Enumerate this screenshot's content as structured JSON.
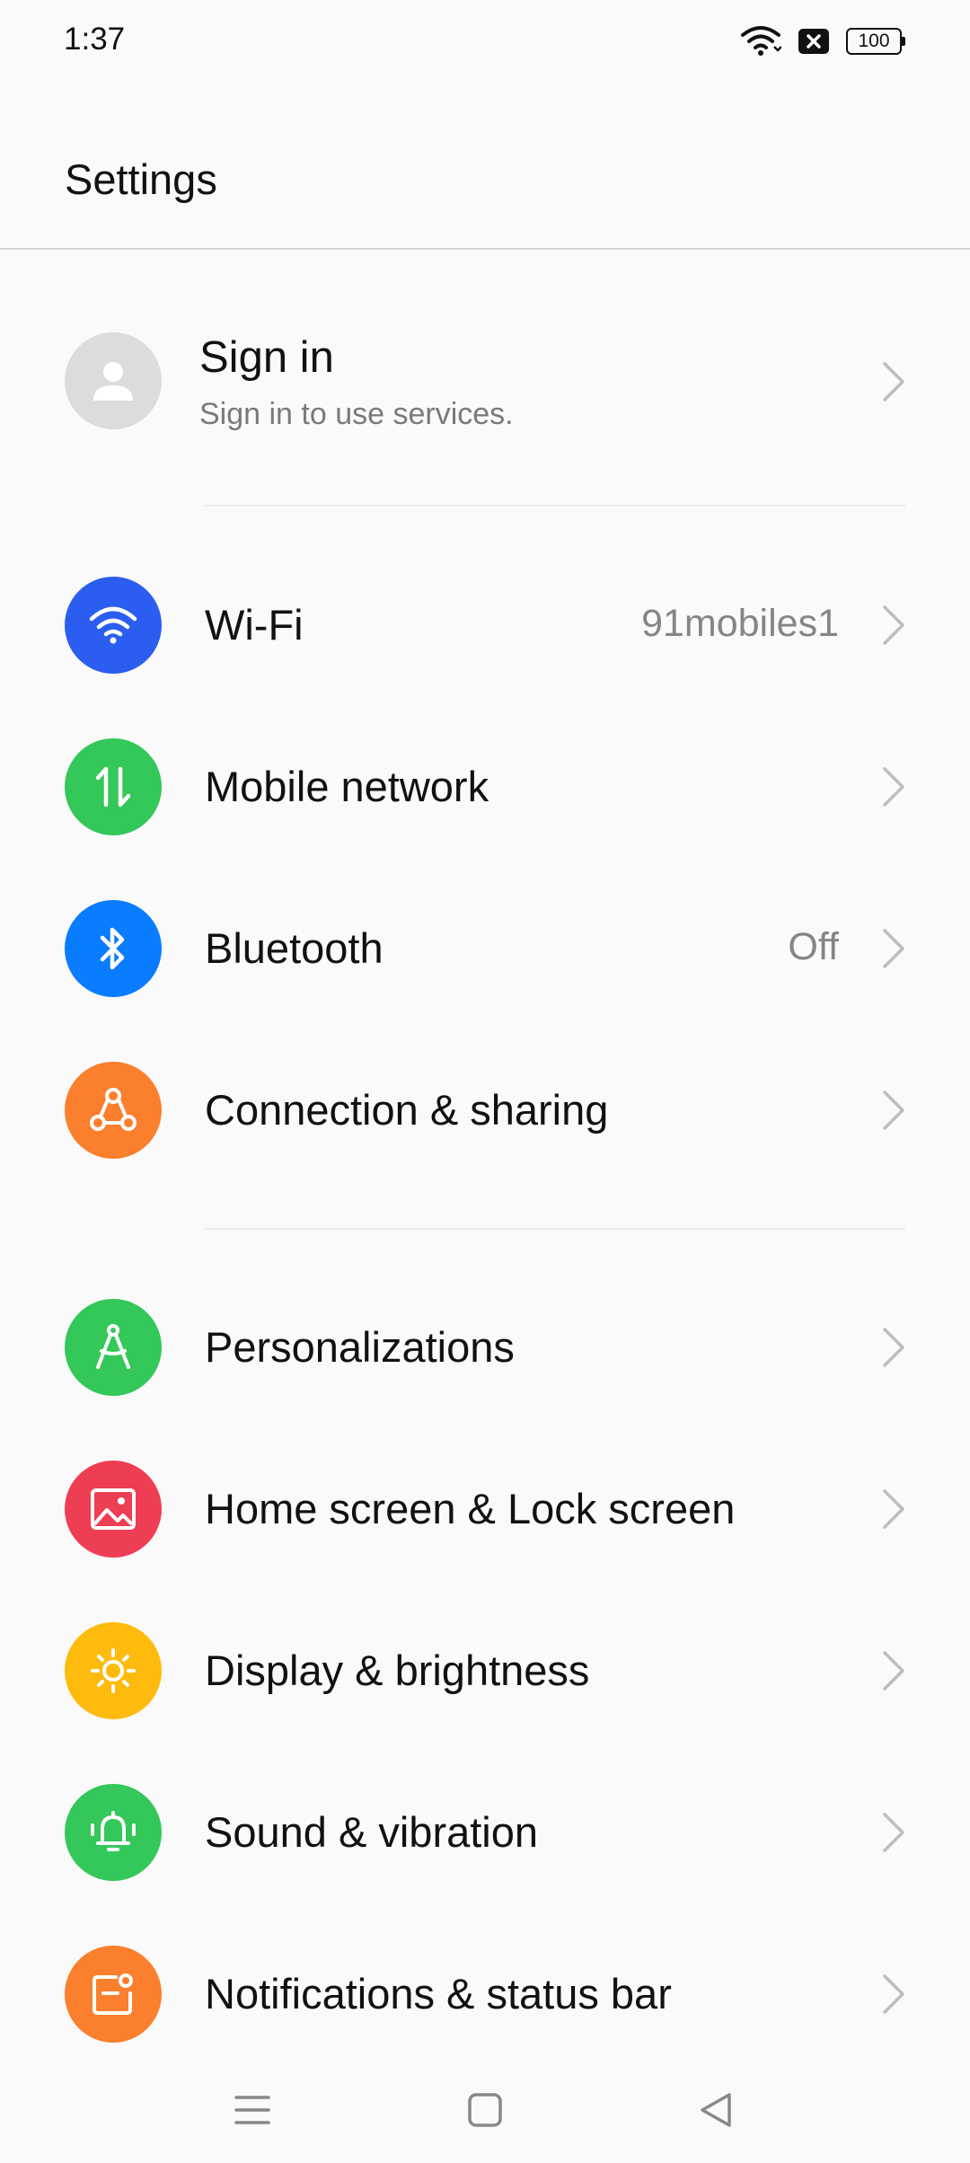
{
  "status_bar": {
    "time": "1:37",
    "battery": "100",
    "icons": [
      "wifi-icon",
      "data-off-icon",
      "battery-icon"
    ]
  },
  "header": {
    "title": "Settings"
  },
  "account": {
    "title": "Sign in",
    "subtitle": "Sign in to use services."
  },
  "groups": [
    [
      {
        "label": "Wi-Fi",
        "value": "91mobiles1",
        "icon": "wifi-icon",
        "color": "#2b5ef0"
      },
      {
        "label": "Mobile network",
        "value": "",
        "icon": "mobile-data-icon",
        "color": "#34c759"
      },
      {
        "label": "Bluetooth",
        "value": "Off",
        "icon": "bluetooth-icon",
        "color": "#0a7cff"
      },
      {
        "label": "Connection & sharing",
        "value": "",
        "icon": "connection-sharing-icon",
        "color": "#fb7f2c"
      }
    ],
    [
      {
        "label": "Personalizations",
        "value": "",
        "icon": "personalization-icon",
        "color": "#34c759"
      },
      {
        "label": "Home screen & Lock screen",
        "value": "",
        "icon": "image-icon",
        "color": "#ee3e54"
      },
      {
        "label": "Display & brightness",
        "value": "",
        "icon": "sun-icon",
        "color": "#ffbb0d"
      },
      {
        "label": "Sound & vibration",
        "value": "",
        "icon": "bell-icon",
        "color": "#34c759"
      },
      {
        "label": "Notifications & status bar",
        "value": "",
        "icon": "notification-icon",
        "color": "#fb7f2c"
      }
    ]
  ],
  "nav": [
    "menu-icon",
    "home-icon",
    "back-icon"
  ]
}
